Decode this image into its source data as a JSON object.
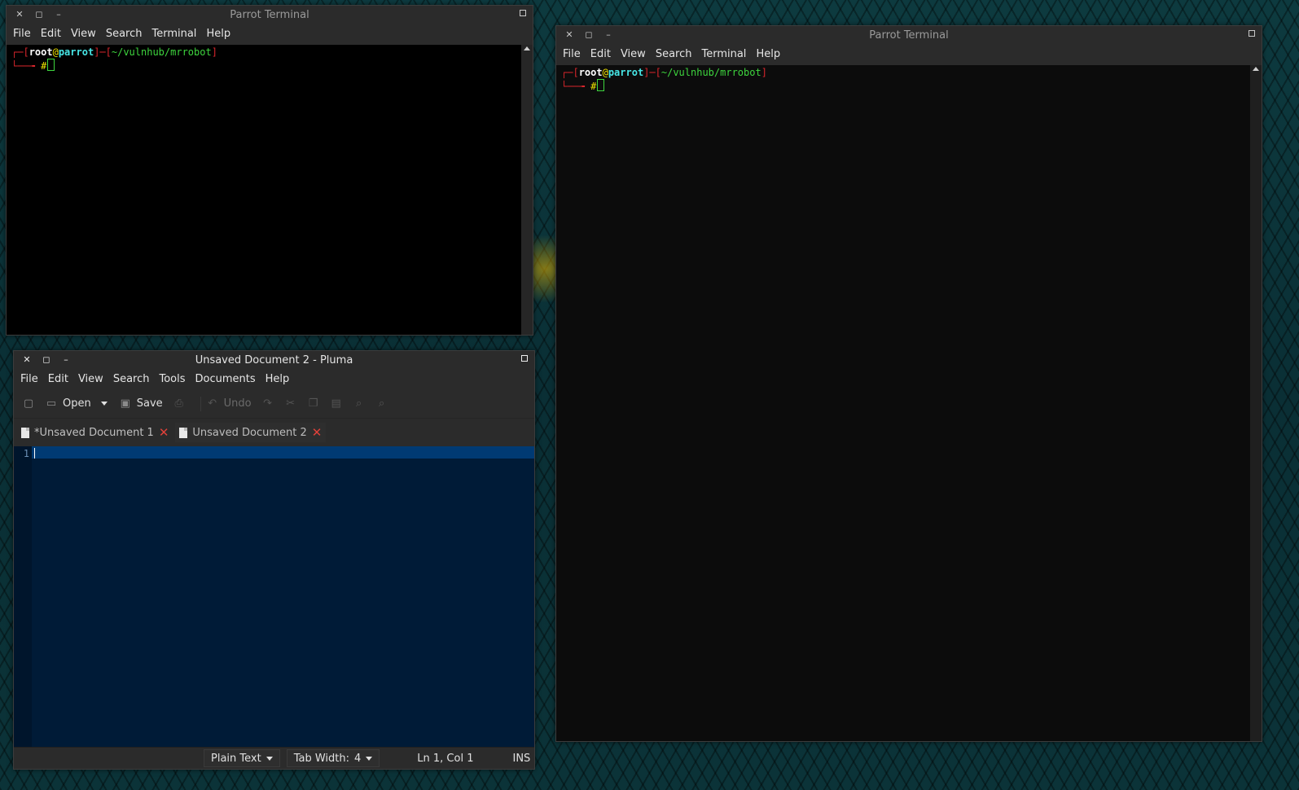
{
  "terminal_left": {
    "title": "Parrot Terminal",
    "menu": [
      "File",
      "Edit",
      "View",
      "Search",
      "Terminal",
      "Help"
    ],
    "prompt": {
      "bracket_open": "┌─[",
      "user": "root",
      "at": "@",
      "host": "parrot",
      "mid": "]─[",
      "path": "~/vulnhub/mrrobot",
      "bracket_close": "]",
      "line2": "└──╼ ",
      "symbol": "#"
    }
  },
  "terminal_right": {
    "title": "Parrot Terminal",
    "menu": [
      "File",
      "Edit",
      "View",
      "Search",
      "Terminal",
      "Help"
    ],
    "prompt": {
      "bracket_open": "┌─[",
      "user": "root",
      "at": "@",
      "host": "parrot",
      "mid": "]─[",
      "path": "~/vulnhub/mrrobot",
      "bracket_close": "]",
      "line2": "└──╼ ",
      "symbol": "#"
    }
  },
  "pluma": {
    "title": "Unsaved Document 2 - Pluma",
    "menu": [
      "File",
      "Edit",
      "View",
      "Search",
      "Tools",
      "Documents",
      "Help"
    ],
    "toolbar": {
      "open": "Open",
      "save": "Save",
      "undo": "Undo"
    },
    "tabs": [
      {
        "label": "*Unsaved Document 1"
      },
      {
        "label": "Unsaved Document 2"
      }
    ],
    "editor": {
      "line_number": "1"
    },
    "status": {
      "language": "Plain Text",
      "tab_width_label": "Tab Width:",
      "tab_width": "4",
      "position": "Ln 1, Col 1",
      "mode": "INS"
    }
  }
}
